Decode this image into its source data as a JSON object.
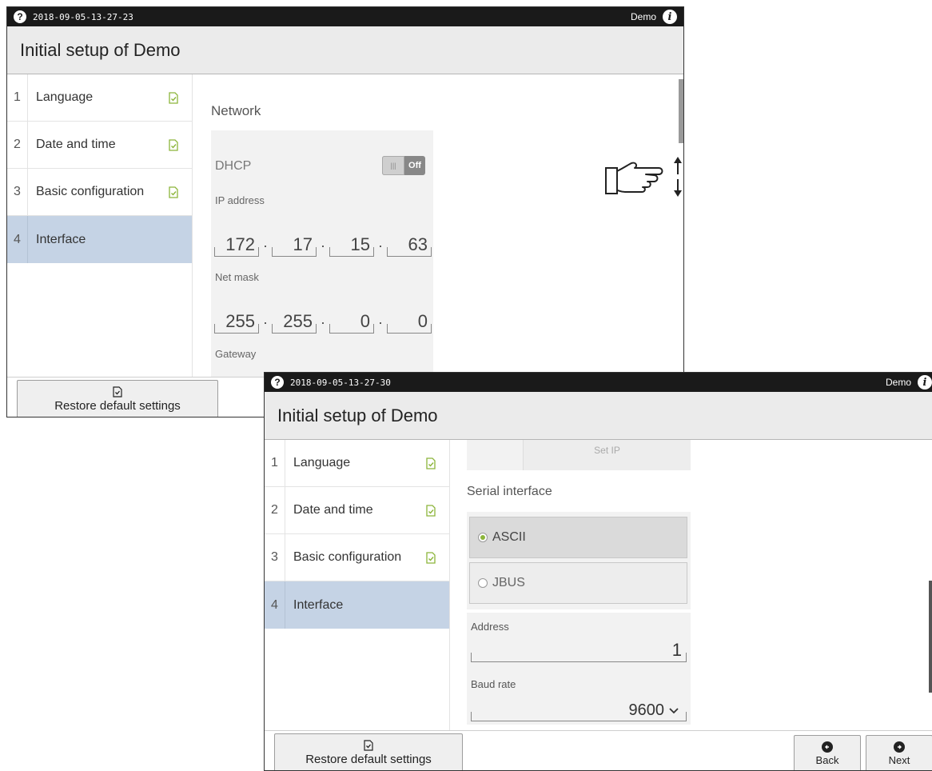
{
  "window1": {
    "statusbar": {
      "help_icon": "?",
      "timestamp": "2018-09-05-13-27-23",
      "user": "Demo",
      "info_icon": "i"
    },
    "title": "Initial setup of Demo",
    "sidebar": {
      "items": [
        {
          "num": "1",
          "label": "Language",
          "checked": true
        },
        {
          "num": "2",
          "label": "Date and time",
          "checked": true
        },
        {
          "num": "3",
          "label": "Basic configuration",
          "checked": true
        },
        {
          "num": "4",
          "label": "Interface",
          "checked": false,
          "active": true
        }
      ]
    },
    "network": {
      "section_title": "Network",
      "dhcp_label": "DHCP",
      "dhcp_toggle_state": "Off",
      "ip_label": "IP address",
      "ip": [
        "172",
        "17",
        "15",
        "63"
      ],
      "netmask_label": "Net mask",
      "netmask": [
        "255",
        "255",
        "0",
        "0"
      ],
      "gateway_label": "Gateway",
      "separator": "·"
    },
    "footer": {
      "restore_label": "Restore default settings"
    }
  },
  "window2": {
    "statusbar": {
      "help_icon": "?",
      "timestamp": "2018-09-05-13-27-30",
      "user": "Demo",
      "info_icon": "i"
    },
    "title": "Initial setup of Demo",
    "sidebar": {
      "items": [
        {
          "num": "1",
          "label": "Language",
          "checked": true
        },
        {
          "num": "2",
          "label": "Date and time",
          "checked": true
        },
        {
          "num": "3",
          "label": "Basic configuration",
          "checked": true
        },
        {
          "num": "4",
          "label": "Interface",
          "checked": false,
          "active": true
        }
      ]
    },
    "set_ip_label": "Set IP",
    "serial": {
      "section_title": "Serial interface",
      "options": [
        {
          "label": "ASCII",
          "selected": true
        },
        {
          "label": "JBUS",
          "selected": false
        }
      ],
      "address_label": "Address",
      "address_value": "1",
      "baud_label": "Baud rate",
      "baud_value": "9600"
    },
    "footer": {
      "restore_label": "Restore default settings",
      "back_label": "Back",
      "next_label": "Next"
    }
  },
  "colors": {
    "check_green": "#8cb53a",
    "active_item": "#c5d3e5",
    "statusbar": "#1a1a1a"
  },
  "icons": {
    "checkmark": "doc-check-icon",
    "scroll_hint": "pointing-hand-icon"
  }
}
